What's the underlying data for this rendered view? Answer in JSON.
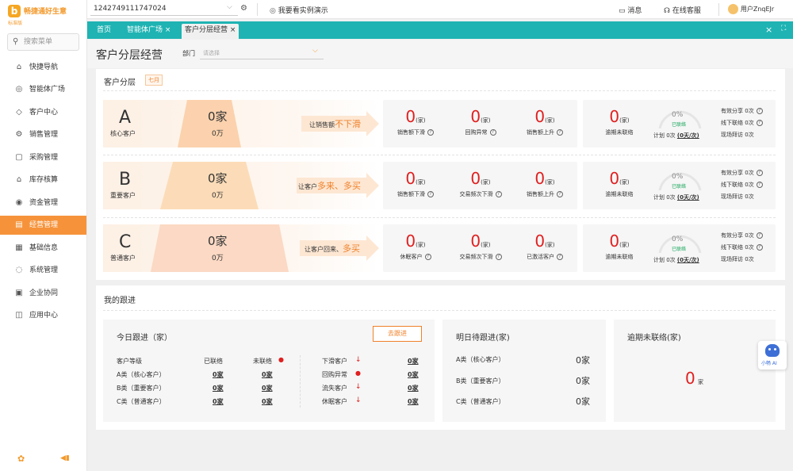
{
  "brand": {
    "name": "畅捷通好生意",
    "edition": "标准版"
  },
  "sidebar": {
    "search_placeholder": "搜索菜单",
    "items": [
      {
        "label": "快捷导航",
        "icon": "home-icon"
      },
      {
        "label": "智能体广场",
        "icon": "ai-icon"
      },
      {
        "label": "客户中心",
        "icon": "diamond-icon"
      },
      {
        "label": "销售管理",
        "icon": "sales-icon"
      },
      {
        "label": "采购管理",
        "icon": "cart-icon"
      },
      {
        "label": "库存核算",
        "icon": "warehouse-icon"
      },
      {
        "label": "资金管理",
        "icon": "money-icon"
      },
      {
        "label": "经营管理",
        "icon": "chart-icon"
      },
      {
        "label": "基础信息",
        "icon": "info-icon"
      },
      {
        "label": "系统管理",
        "icon": "system-icon"
      },
      {
        "label": "企业协同",
        "icon": "collab-icon"
      },
      {
        "label": "应用中心",
        "icon": "apps-icon"
      }
    ],
    "active_index": 7
  },
  "topbar": {
    "account": "1242749111747024",
    "demo": "我要看实例演示",
    "messages": "消息",
    "service": "在线客服",
    "user": "用户ZnqEJr"
  },
  "tabs": [
    {
      "label": "首页",
      "closable": false
    },
    {
      "label": "智能体广场",
      "closable": true
    },
    {
      "label": "客户分层经营",
      "closable": true
    }
  ],
  "page": {
    "title": "客户分层经营",
    "dept_label": "部门",
    "dept_placeholder": "请选择"
  },
  "segment_section": {
    "title": "客户分层",
    "month": "七月",
    "rows": [
      {
        "letter": "A",
        "name": "核心客户",
        "count": "0家",
        "amount": "0万",
        "slogan_plain": "让销售额",
        "slogan_hl": "不下滑",
        "metrics": [
          {
            "value": "0",
            "unit": "(家)",
            "label": "销售额下滑"
          },
          {
            "value": "0",
            "unit": "(家)",
            "label": "回购异常"
          },
          {
            "value": "0",
            "unit": "(家)",
            "label": "销售额上升"
          }
        ],
        "overdue": {
          "value": "0",
          "unit": "(家)",
          "label": "逾期未联络"
        },
        "gauge": {
          "percent": "0%",
          "status": "已联络",
          "plan_prefix": "计划 0次",
          "plan_link": "(0天/次)"
        },
        "stats": [
          {
            "label": "有效分享",
            "value": "0次",
            "help": true
          },
          {
            "label": "线下联络",
            "value": "0次",
            "help": true
          },
          {
            "label": "现场拜访",
            "value": "0次",
            "help": false
          }
        ]
      },
      {
        "letter": "B",
        "name": "重要客户",
        "count": "0家",
        "amount": "0万",
        "slogan_plain": "让客户",
        "slogan_hl": "多来、多买",
        "metrics": [
          {
            "value": "0",
            "unit": "(家)",
            "label": "销售额下滑"
          },
          {
            "value": "0",
            "unit": "(家)",
            "label": "交易频次下滑"
          },
          {
            "value": "0",
            "unit": "(家)",
            "label": "销售额上升"
          }
        ],
        "overdue": {
          "value": "0",
          "unit": "(家)",
          "label": "逾期未联络"
        },
        "gauge": {
          "percent": "0%",
          "status": "已联络",
          "plan_prefix": "计划 0次",
          "plan_link": "(0天/次)"
        },
        "stats": [
          {
            "label": "有效分享",
            "value": "0次",
            "help": true
          },
          {
            "label": "线下联络",
            "value": "0次",
            "help": true
          },
          {
            "label": "现场拜访",
            "value": "0次",
            "help": false
          }
        ]
      },
      {
        "letter": "C",
        "name": "普通客户",
        "count": "0家",
        "amount": "0万",
        "slogan_plain": "让客户回来、",
        "slogan_hl": "多买",
        "metrics": [
          {
            "value": "0",
            "unit": "(家)",
            "label": "休眠客户"
          },
          {
            "value": "0",
            "unit": "(家)",
            "label": "交易频次下滑"
          },
          {
            "value": "0",
            "unit": "(家)",
            "label": "已激活客户"
          }
        ],
        "overdue": {
          "value": "0",
          "unit": "(家)",
          "label": "逾期未联络"
        },
        "gauge": {
          "percent": "0%",
          "status": "已联络",
          "plan_prefix": "计划 0次",
          "plan_link": "(0天/次)"
        },
        "stats": [
          {
            "label": "有效分享",
            "value": "0次",
            "help": true
          },
          {
            "label": "线下联络",
            "value": "0次",
            "help": true
          },
          {
            "label": "现场拜访",
            "value": "0次",
            "help": false
          }
        ]
      }
    ]
  },
  "followup": {
    "title": "我的跟进",
    "today": {
      "title": "今日跟进（家）",
      "button": "去跟进",
      "headers": [
        "客户等级",
        "已联络",
        "未联络"
      ],
      "rows": [
        {
          "level": "A类（核心客户）",
          "contacted": "0家",
          "uncontacted": "0家"
        },
        {
          "level": "B类（重要客户）",
          "contacted": "0家",
          "uncontacted": "0家"
        },
        {
          "level": "C类（普通客户）",
          "contacted": "0家",
          "uncontacted": "0家"
        }
      ],
      "alerts": [
        {
          "label": "下滑客户",
          "type": "down",
          "value": "0家"
        },
        {
          "label": "回购异常",
          "type": "alert",
          "value": "0家"
        },
        {
          "label": "流失客户",
          "type": "down",
          "value": "0家"
        },
        {
          "label": "休眠客户",
          "type": "down",
          "value": "0家"
        }
      ]
    },
    "tomorrow": {
      "title": "明日待跟进(家)",
      "rows": [
        {
          "level": "A类（核心客户）",
          "value": "0家"
        },
        {
          "level": "B类（重要客户）",
          "value": "0家"
        },
        {
          "level": "C类（普通客户）",
          "value": "0家"
        }
      ]
    },
    "overdue": {
      "title": "逾期未联络(家)",
      "value": "0",
      "unit": "家"
    }
  },
  "assistant": {
    "label": "小畅 AI"
  },
  "colors": {
    "brand_orange": "#f6933a",
    "teal": "#1fb3b3",
    "alert_red": "#e02020"
  }
}
